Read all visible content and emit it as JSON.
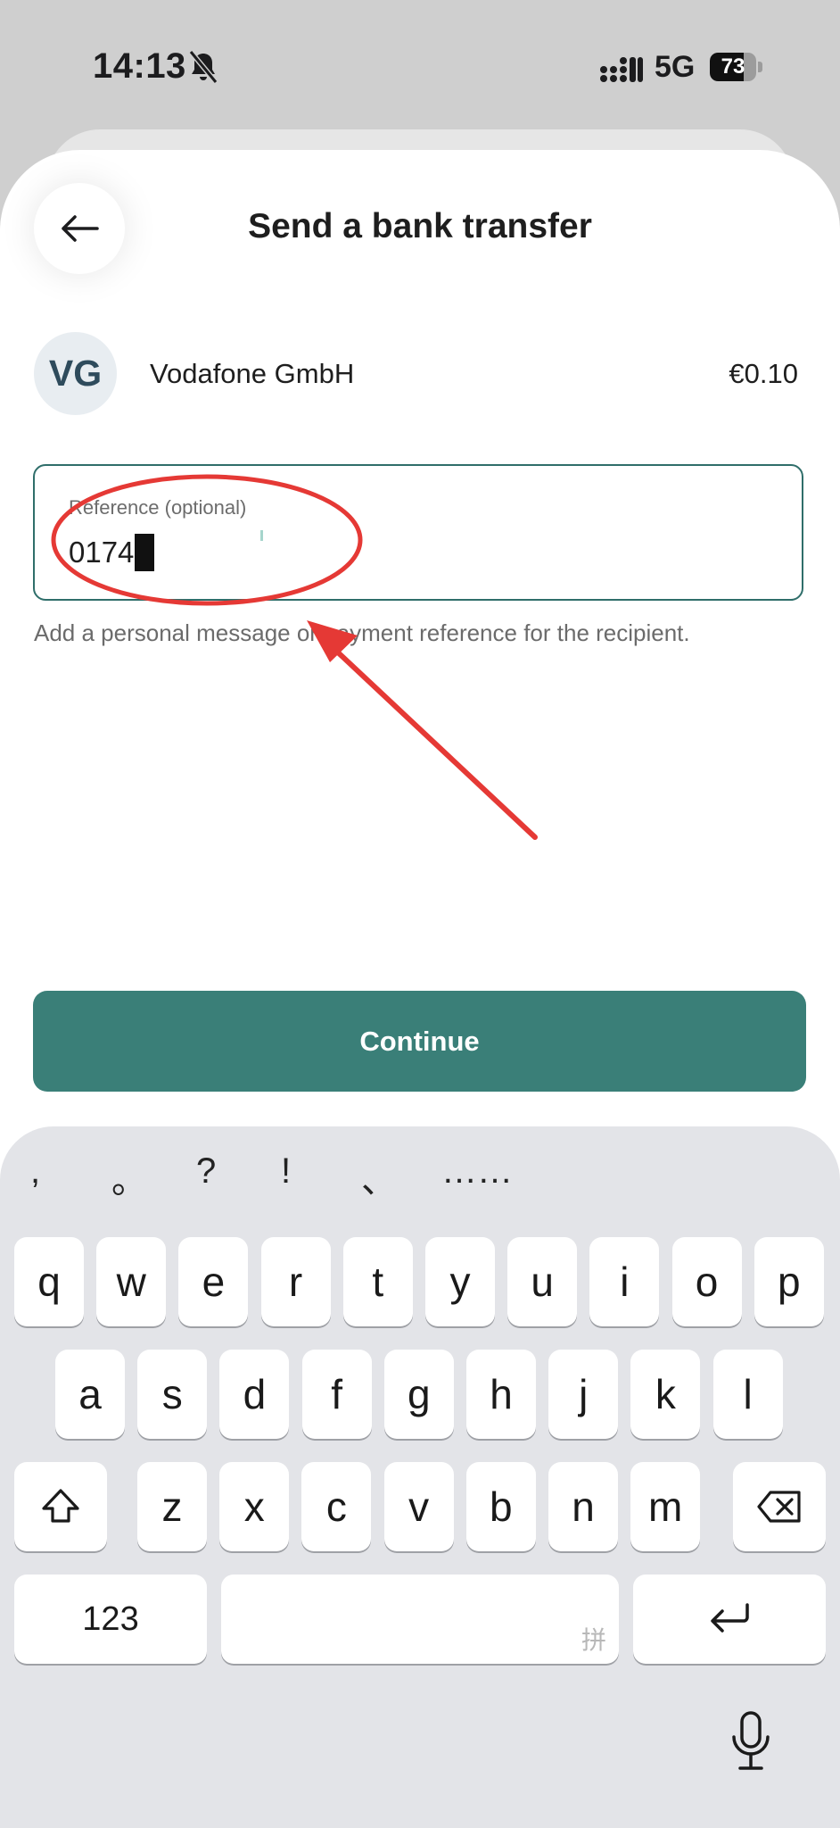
{
  "status_bar": {
    "time": "14:13",
    "network": "5G",
    "battery": "73",
    "battery_level": 0.73
  },
  "header": {
    "title": "Send a bank transfer",
    "back_icon": "arrow-left-icon"
  },
  "recipient": {
    "initials": "VG",
    "name": "Vodafone GmbH",
    "amount": "€0.10"
  },
  "reference": {
    "label": "Reference (optional)",
    "value": "0174",
    "hint": "Add a personal message or payment reference for the recipient."
  },
  "continue_label": "Continue",
  "colors": {
    "accent": "#3a7f78",
    "field_border": "#2f6e6a",
    "annotation": "#e53935"
  },
  "keyboard": {
    "suggestions": [
      ",",
      "。",
      "?",
      "!",
      "、",
      "……"
    ],
    "row1": [
      "q",
      "w",
      "e",
      "r",
      "t",
      "y",
      "u",
      "i",
      "o",
      "p"
    ],
    "row2": [
      "a",
      "s",
      "d",
      "f",
      "g",
      "h",
      "j",
      "k",
      "l"
    ],
    "row3": [
      "z",
      "x",
      "c",
      "v",
      "b",
      "n",
      "m"
    ],
    "numbers_label": "123",
    "space_hint": "拼",
    "icons": {
      "shift": "shift-icon",
      "delete": "backspace-icon",
      "return": "return-icon",
      "mic": "microphone-icon"
    }
  }
}
